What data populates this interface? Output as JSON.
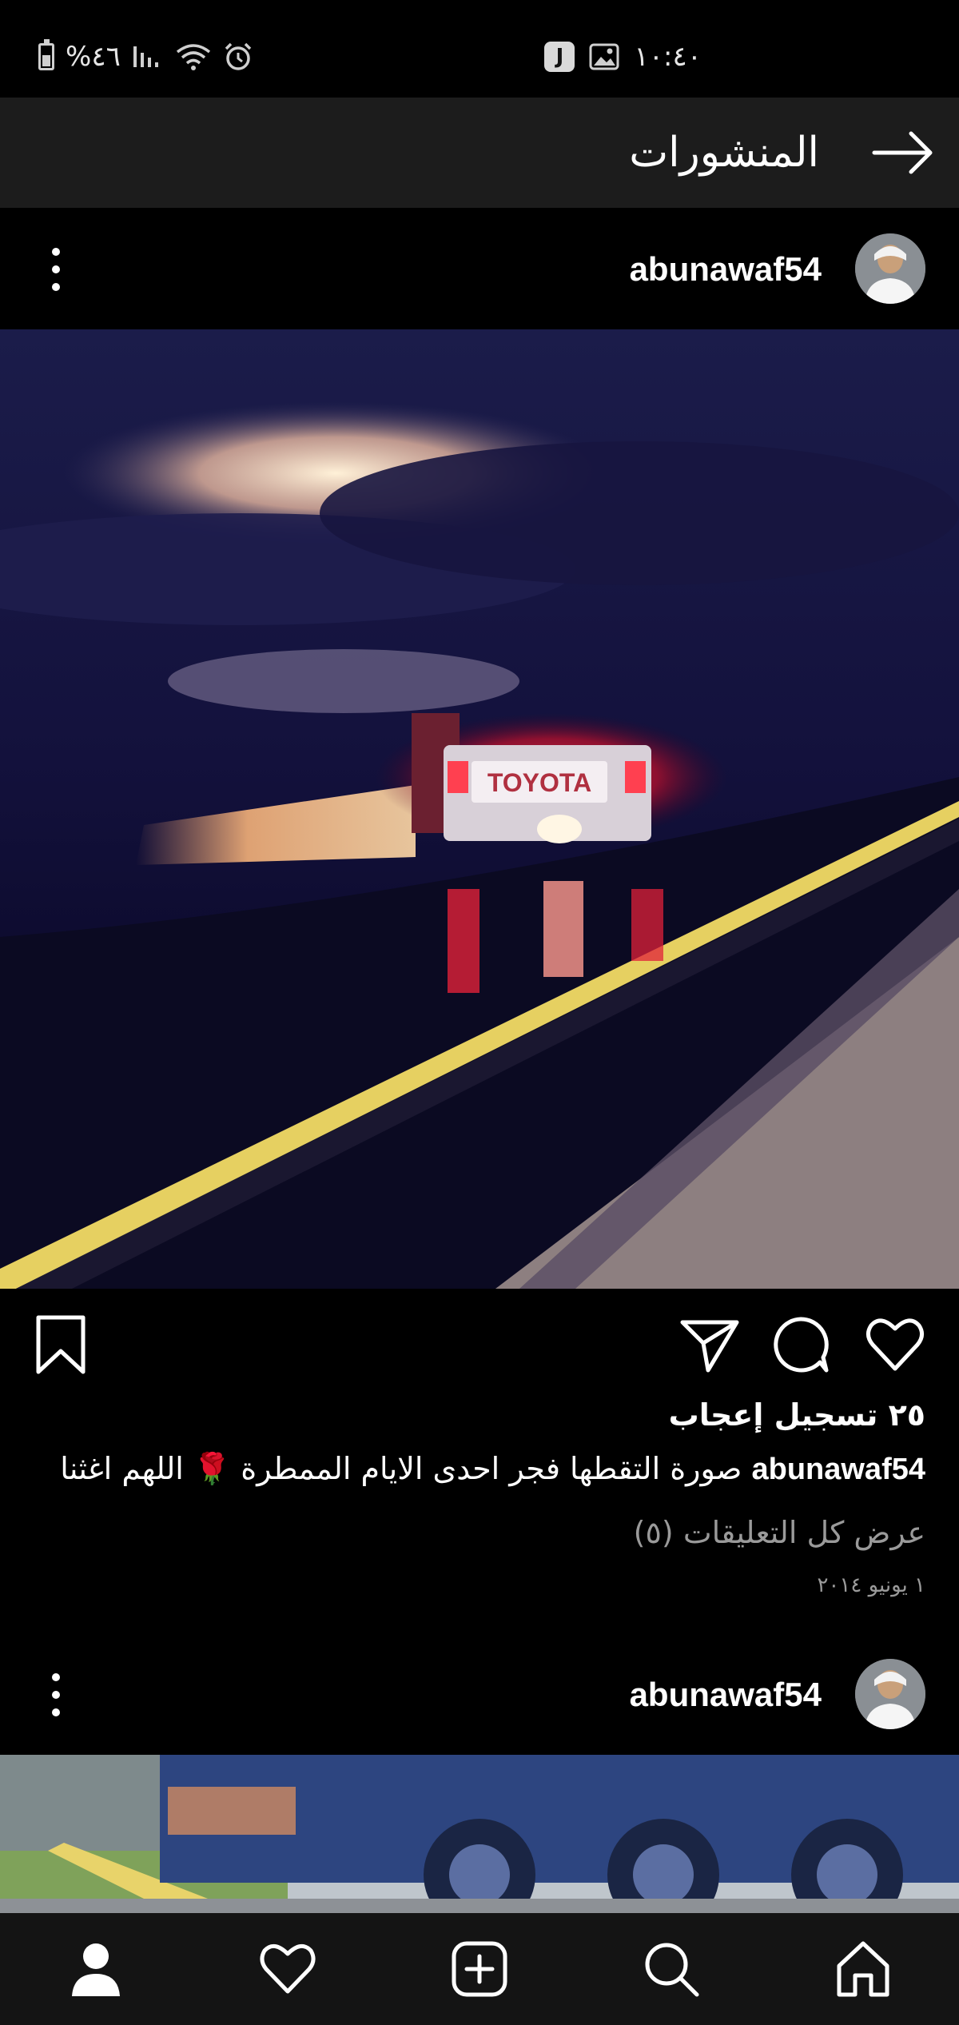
{
  "status_bar": {
    "battery_percent": "%٤٦",
    "time": "١٠:٤٠",
    "app_badge": "J"
  },
  "header": {
    "title": "المنشورات"
  },
  "post1": {
    "username": "abunawaf54",
    "photo_plate_text": "TOYOTA",
    "likes": "٢٥ تسجيل إعجاب",
    "caption_user": "abunawaf54",
    "caption_text": " صورة التقطها فجر احدى الايام الممطرة 🌹 اللهم  اغثنا",
    "view_comments": "عرض كل التعليقات (٥)",
    "date": "١ يونيو ٢٠١٤"
  },
  "post2": {
    "username": "abunawaf54"
  },
  "icons": {
    "back": "arrow-right-icon",
    "more": "more-vertical-icon",
    "like": "heart-icon",
    "comment": "comment-icon",
    "share": "send-icon",
    "save": "bookmark-icon",
    "nav_profile": "profile-icon",
    "nav_activity": "heart-icon",
    "nav_create": "add-post-icon",
    "nav_search": "search-icon",
    "nav_home": "home-icon"
  }
}
